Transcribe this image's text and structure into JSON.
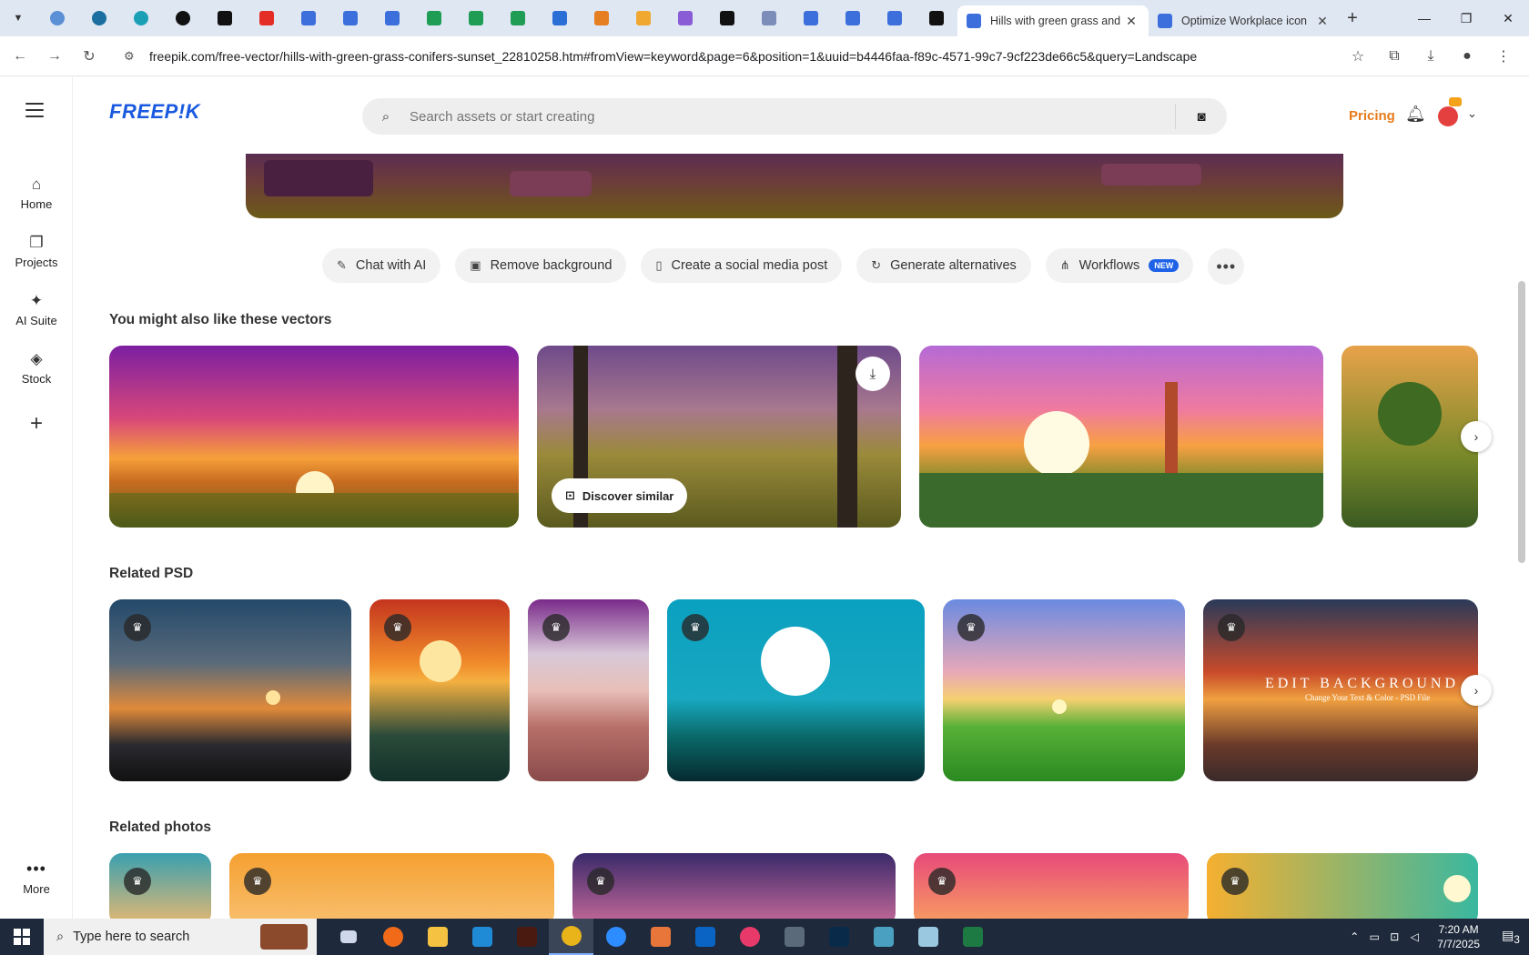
{
  "browser": {
    "active_tab_title": "Hills with green grass and",
    "other_tab_title": "Optimize Workplace icon",
    "url": "freepik.com/free-vector/hills-with-green-grass-conifers-sunset_22810258.htm#fromView=keyword&page=6&position=1&uuid=b4446faa-f89c-4571-99c7-9cf223de66c5&query=Landscape"
  },
  "sidebar": {
    "items": [
      {
        "label": "Home",
        "icon": "home-icon"
      },
      {
        "label": "Projects",
        "icon": "projects-icon"
      },
      {
        "label": "AI Suite",
        "icon": "sparkle-icon"
      },
      {
        "label": "Stock",
        "icon": "stock-icon"
      }
    ],
    "more_label": "More"
  },
  "header": {
    "logo": "FREEP!K",
    "search_placeholder": "Search assets or start creating",
    "pricing": "Pricing"
  },
  "toolbar": {
    "items": [
      {
        "label": "Chat with AI"
      },
      {
        "label": "Remove background"
      },
      {
        "label": "Create a social media post"
      },
      {
        "label": "Generate alternatives"
      },
      {
        "label": "Workflows",
        "badge": "NEW"
      }
    ]
  },
  "sections": {
    "vectors_title": "You might also like these vectors",
    "discover_label": "Discover similar",
    "psd_title": "Related PSD",
    "psd_card_text": "EDIT BACKGROUND",
    "psd_card_subtext": "Change Your Text & Color - PSD File",
    "photos_title": "Related photos"
  },
  "taskbar": {
    "search_text": "Type here to search",
    "time": "7:20 AM",
    "date": "7/7/2025",
    "notification_count": "3"
  },
  "colors": {
    "brand": "#1a5ae0",
    "pricing": "#e77b1a",
    "badge": "#1e62e8"
  }
}
